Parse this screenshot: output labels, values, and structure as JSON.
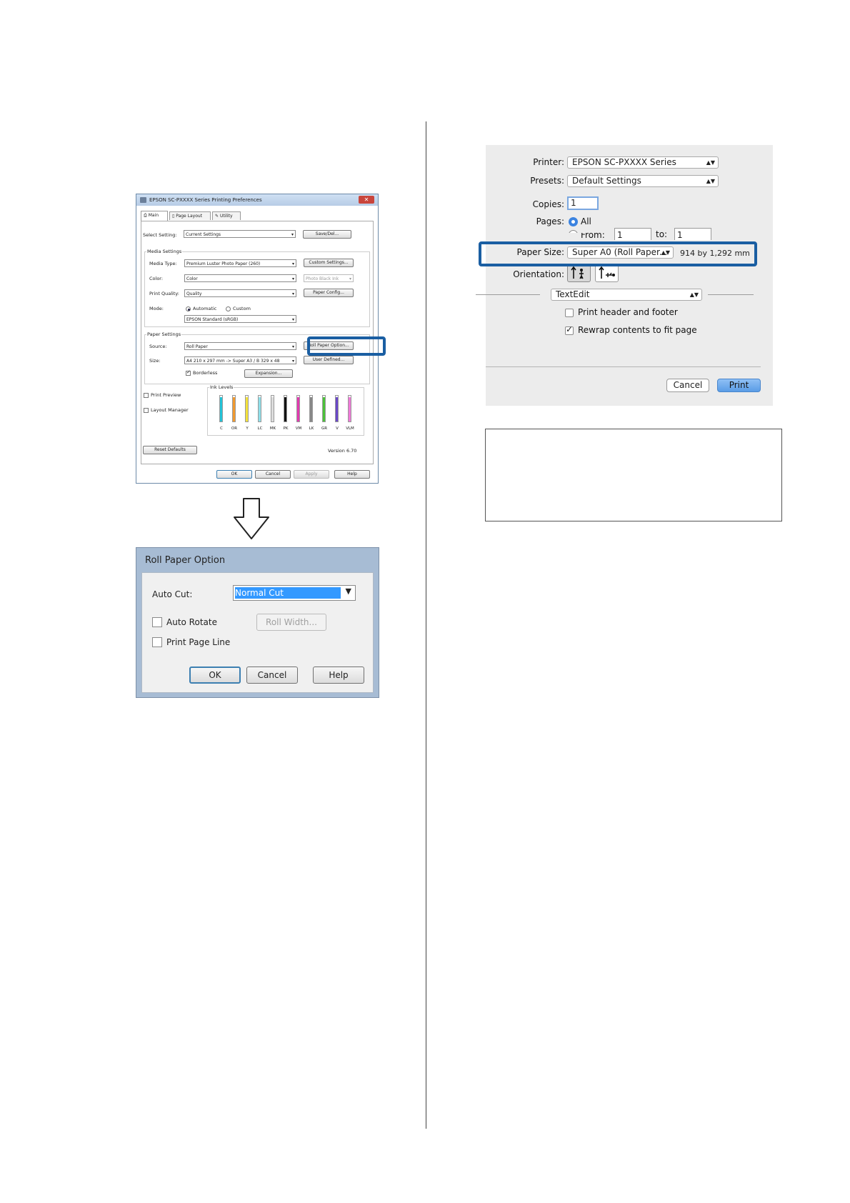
{
  "win": {
    "title": "EPSON SC-PXXXX Series Printing Preferences",
    "close": "✕",
    "tabs": [
      "Main",
      "Page Layout",
      "Utility"
    ],
    "select_setting_label": "Select Setting:",
    "select_setting_value": "Current Settings",
    "save_del": "Save/Del...",
    "media_settings": "Media Settings",
    "media_type_label": "Media Type:",
    "media_type_value": "Premium Luster Photo Paper (260)",
    "custom_settings": "Custom Settings...",
    "color_label": "Color:",
    "color_value": "Color",
    "black_ink": "Photo Black Ink",
    "print_quality_label": "Print Quality:",
    "print_quality_value": "Quality",
    "paper_config": "Paper Config...",
    "mode_label": "Mode:",
    "mode_automatic": "Automatic",
    "mode_custom": "Custom",
    "mode_value": "EPSON Standard (sRGB)",
    "paper_settings": "Paper Settings",
    "source_label": "Source:",
    "source_value": "Roll Paper",
    "roll_paper_option": "Roll Paper Option...",
    "size_label": "Size:",
    "size_value": "A4 210 x 297 mm -> Super A3 / B 329 x 48",
    "user_defined": "User Defined...",
    "borderless": "Borderless",
    "expansion": "Expansion...",
    "print_preview": "Print Preview",
    "layout_manager": "Layout Manager",
    "ink_levels": "Ink Levels",
    "inks": [
      {
        "label": "C",
        "color": "#22c4d8",
        "level": 0.95
      },
      {
        "label": "OR",
        "color": "#f29a2e",
        "level": 0.95
      },
      {
        "label": "Y",
        "color": "#f4e23a",
        "level": 0.95
      },
      {
        "label": "LC",
        "color": "#8fe0ea",
        "level": 0.95
      },
      {
        "label": "MK",
        "color": "#dddddd",
        "level": 0.95
      },
      {
        "label": "PK",
        "color": "#111111",
        "level": 0.95
      },
      {
        "label": "VM",
        "color": "#e23ab0",
        "level": 0.95
      },
      {
        "label": "LK",
        "color": "#888888",
        "level": 0.95
      },
      {
        "label": "GR",
        "color": "#4cc23a",
        "level": 0.95
      },
      {
        "label": "V",
        "color": "#6a48c8",
        "level": 0.95
      },
      {
        "label": "VLM",
        "color": "#f07ad8",
        "level": 0.95
      }
    ],
    "reset_defaults": "Reset Defaults",
    "version": "Version 6.70",
    "ok": "OK",
    "cancel": "Cancel",
    "apply": "Apply",
    "help": "Help"
  },
  "rpo": {
    "title": "Roll Paper Option",
    "auto_cut_label": "Auto Cut:",
    "auto_cut_value": "Normal Cut",
    "auto_rotate": "Auto Rotate",
    "roll_width": "Roll Width...",
    "print_page_line": "Print Page Line",
    "ok": "OK",
    "cancel": "Cancel",
    "help": "Help"
  },
  "mac": {
    "printer_label": "Printer:",
    "printer_value": "EPSON SC-PXXXX Series",
    "presets_label": "Presets:",
    "presets_value": "Default Settings",
    "copies_label": "Copies:",
    "copies_value": "1",
    "pages_label": "Pages:",
    "pages_all": "All",
    "pages_from": "From:",
    "from_value": "1",
    "to_label": "to:",
    "to_value": "1",
    "paper_size_label": "Paper Size:",
    "paper_size_value": "Super A0 (Roll Paper...",
    "paper_size_dims": "914 by 1,292 mm",
    "orientation_label": "Orientation:",
    "app_menu": "TextEdit",
    "print_header_footer": "Print header and footer",
    "rewrap": "Rewrap contents to fit page",
    "cancel": "Cancel",
    "print": "Print"
  },
  "colors": {
    "highlight": "#1a5ea2",
    "selection": "#3399ff"
  }
}
